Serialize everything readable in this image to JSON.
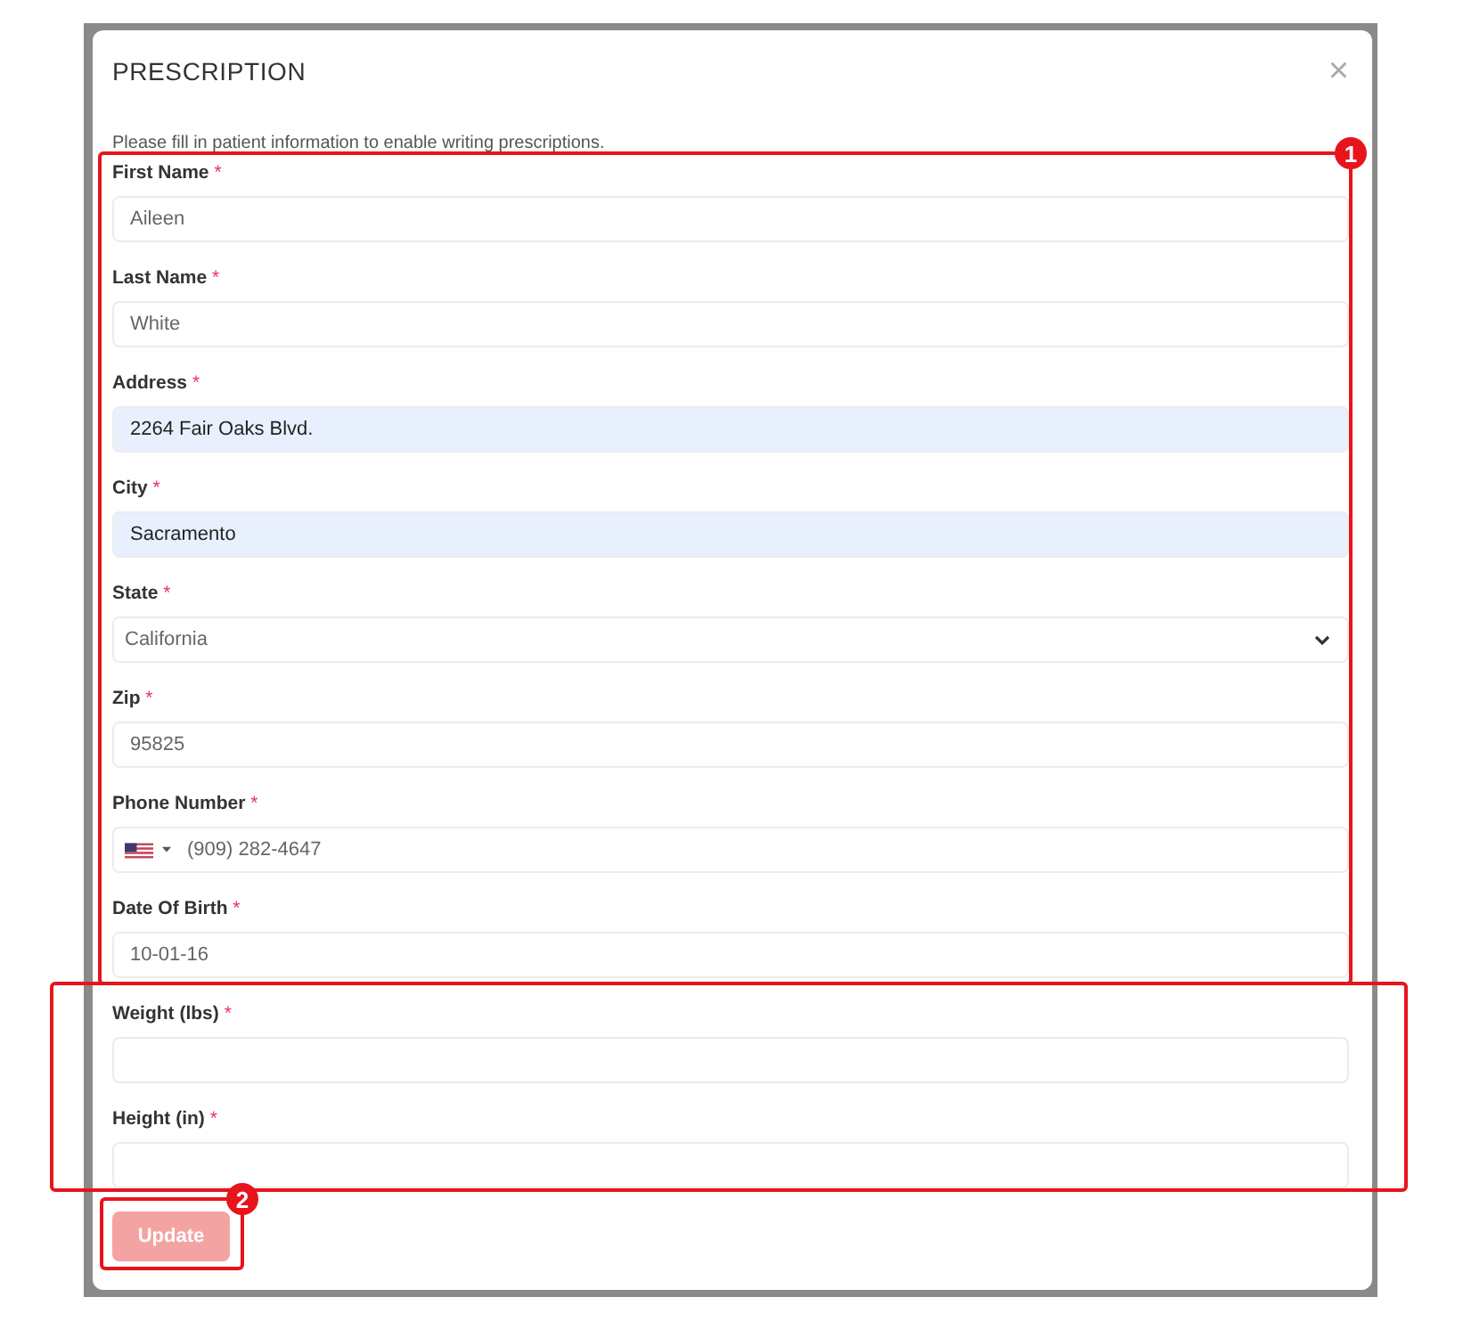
{
  "modal": {
    "title": "PRESCRIPTION",
    "close": "×",
    "description": "Please fill in patient information to enable writing prescriptions."
  },
  "sections": [
    {
      "callout": {
        "kind": "tight",
        "badge": "1"
      },
      "fields": [
        {
          "kind": "text",
          "label": "First Name",
          "required_mark": "*",
          "value": "Aileen",
          "autofilled": false
        },
        {
          "kind": "text",
          "label": "Last Name",
          "required_mark": "*",
          "value": "White",
          "autofilled": false
        },
        {
          "kind": "text",
          "label": "Address",
          "required_mark": "*",
          "value": "2264 Fair Oaks Blvd.",
          "autofilled": true
        },
        {
          "kind": "text",
          "label": "City",
          "required_mark": "*",
          "value": "Sacramento",
          "autofilled": true
        },
        {
          "kind": "select",
          "label": "State",
          "required_mark": "*",
          "value": "California",
          "autofilled": false
        },
        {
          "kind": "text",
          "label": "Zip",
          "required_mark": "*",
          "value": "95825",
          "autofilled": false
        },
        {
          "kind": "phone",
          "label": "Phone Number",
          "required_mark": "*",
          "value": "(909) 282-4647",
          "autofilled": false
        },
        {
          "kind": "text",
          "label": "Date Of Birth",
          "required_mark": "*",
          "value": "10-01-16",
          "autofilled": false
        }
      ]
    },
    {
      "callout": {
        "kind": "wide"
      },
      "fields": [
        {
          "kind": "text",
          "label": "Weight (lbs)",
          "required_mark": "*",
          "autofilled": false
        },
        {
          "kind": "text",
          "label": "Height (in)",
          "required_mark": "*",
          "autofilled": false
        }
      ]
    }
  ],
  "update_button": {
    "label": "Update",
    "disabled": true,
    "callout": {
      "kind": "button",
      "badge": "2"
    }
  }
}
